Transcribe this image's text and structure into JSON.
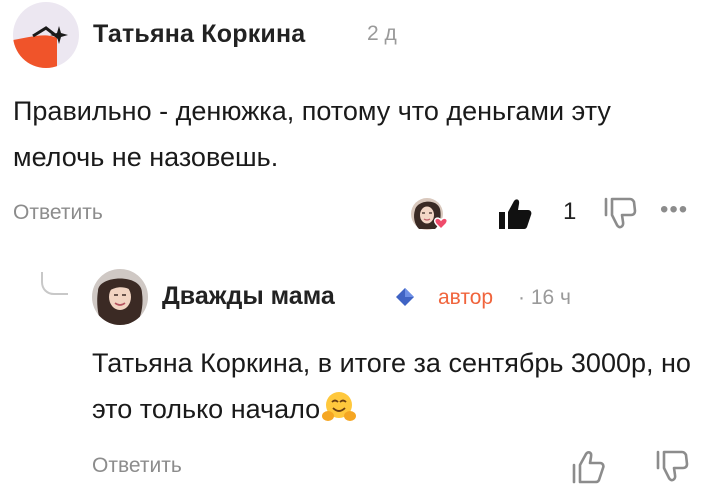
{
  "comment": {
    "author": "Татьяна Коркина",
    "time": "2 д",
    "text": "Правильно - денюжка, потому что деньгами эту мелочь не назовешь.",
    "reply_label": "Ответить",
    "likes": "1",
    "more_label": "•••"
  },
  "reply": {
    "author": "Дважды мама",
    "badge": "автор",
    "time": "· 16 ч",
    "text": "Татьяна Коркина, в итоге за сентябрь 3000р, но это только начало",
    "reply_label": "Ответить"
  },
  "colors": {
    "accent": "#f0643c",
    "muted": "#8c8c8c",
    "verified": "#3f63c4"
  }
}
